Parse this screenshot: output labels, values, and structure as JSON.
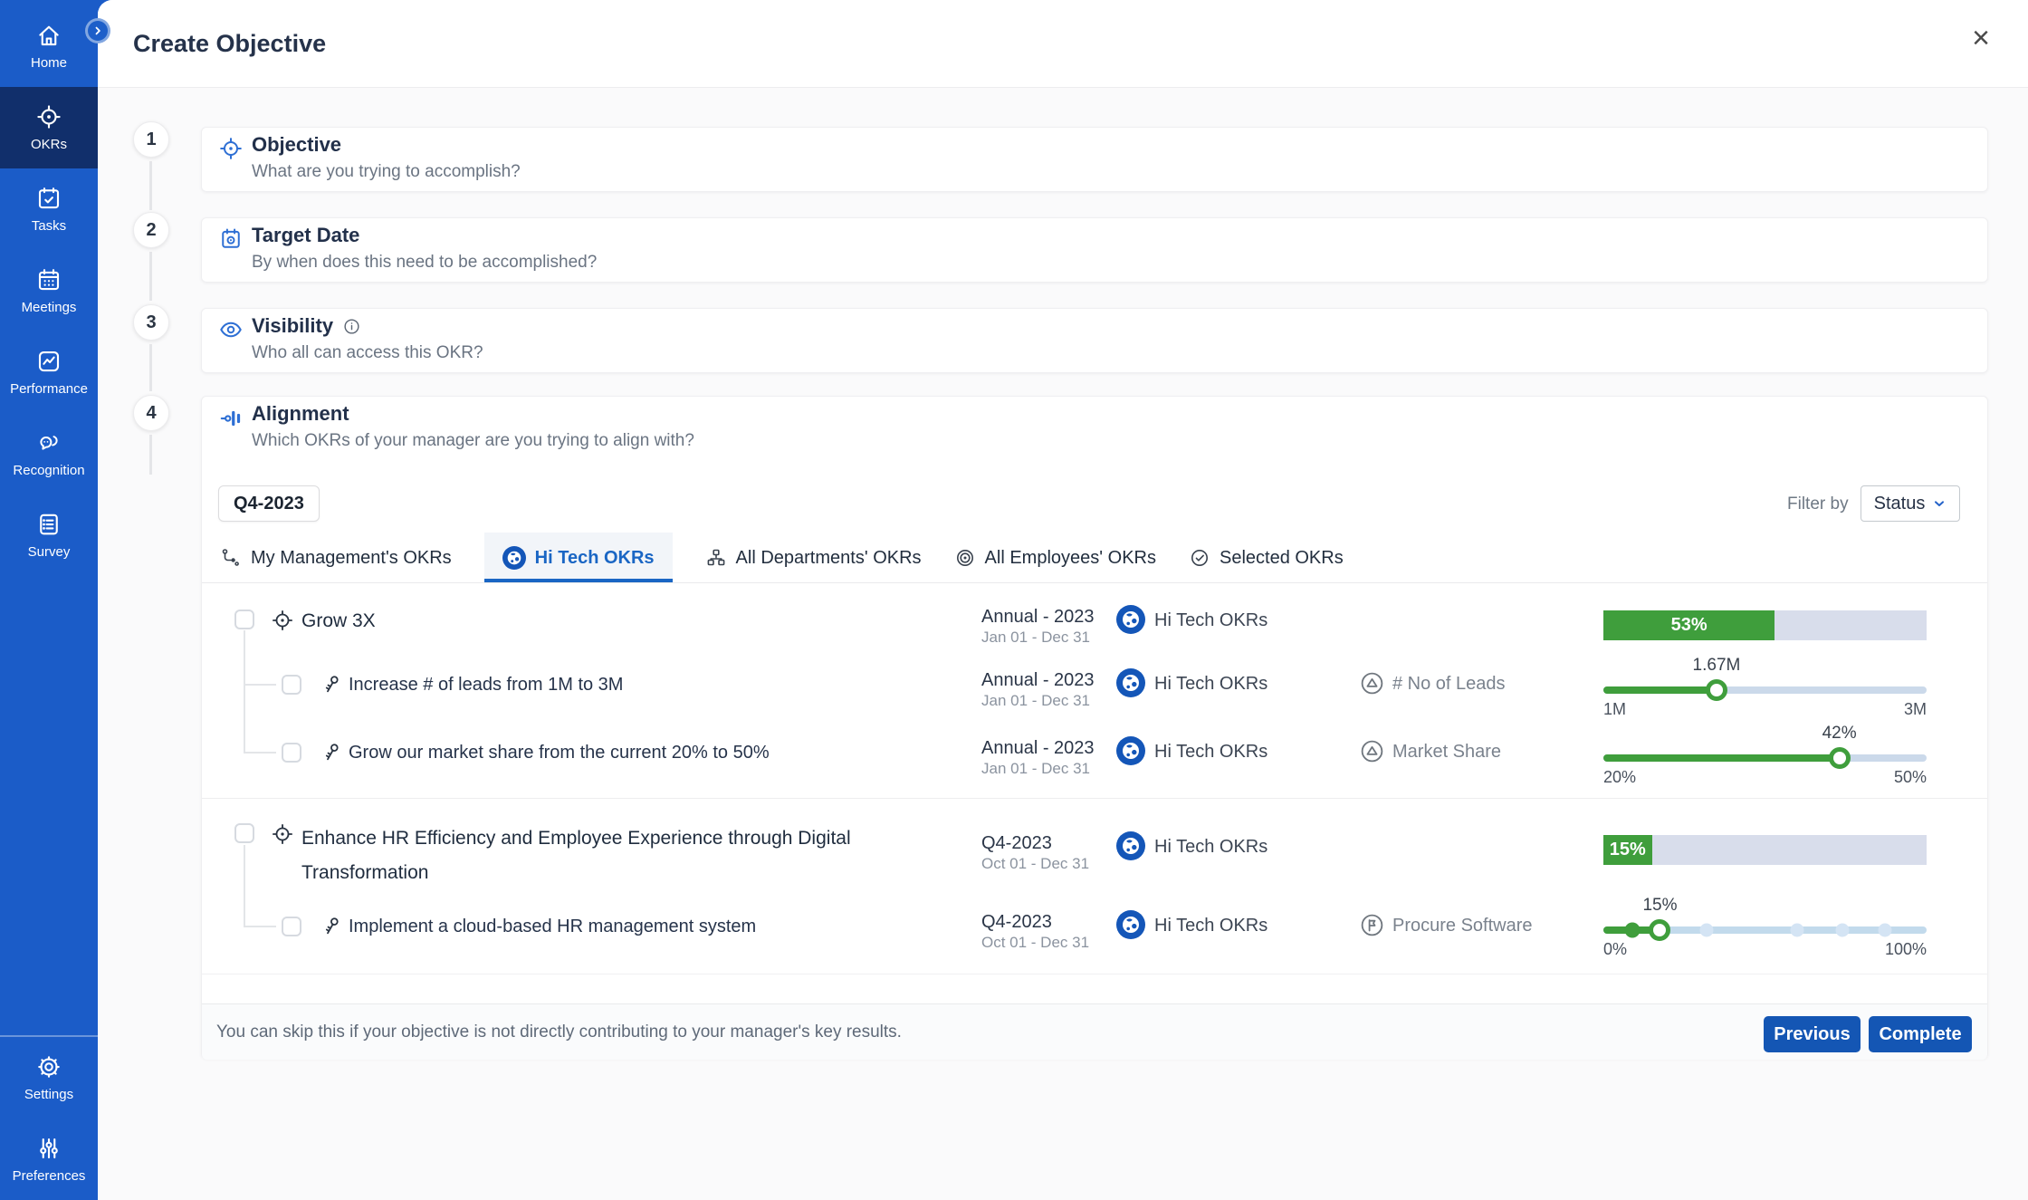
{
  "colors": {
    "sidebar_blue": "#1B5CC8",
    "sidebar_active": "#112F6B",
    "accent_blue": "#1A66C4",
    "step_icon_blue": "#2E6FD4",
    "progress_green": "#3F9E3C",
    "bar_track": "#D8DDEB",
    "slider_track": "#CBD9EA",
    "button_blue": "#1456B4"
  },
  "sidebar": {
    "items": [
      {
        "label": "Home"
      },
      {
        "label": "OKRs"
      },
      {
        "label": "Tasks"
      },
      {
        "label": "Meetings"
      },
      {
        "label": "Performance"
      },
      {
        "label": "Recognition"
      },
      {
        "label": "Survey"
      }
    ],
    "bottom_items": [
      {
        "label": "Settings"
      },
      {
        "label": "Preferences"
      }
    ]
  },
  "header": {
    "title": "Create Objective",
    "close": "×"
  },
  "steps": [
    {
      "number": "1",
      "title": "Objective",
      "subtitle": "What are you trying to accomplish?"
    },
    {
      "number": "2",
      "title": "Target Date",
      "subtitle": "By when does this need to be accomplished?"
    },
    {
      "number": "3",
      "title": "Visibility",
      "subtitle": "Who all can access this OKR?"
    },
    {
      "number": "4",
      "title": "Alignment",
      "subtitle": "Which OKRs of your manager are you trying to align with?"
    }
  ],
  "alignment": {
    "period_chip": "Q4-2023",
    "filter_label": "Filter by",
    "filter_value": "Status",
    "tabs": [
      {
        "label": "My Management's OKRs"
      },
      {
        "label": "Hi Tech OKRs"
      },
      {
        "label": "All Departments' OKRs"
      },
      {
        "label": "All Employees' OKRs"
      },
      {
        "label": "Selected OKRs"
      }
    ],
    "rows": [
      {
        "type": "objective",
        "title": "Grow 3X",
        "period": "Annual - 2023",
        "dates": "Jan 01 - Dec 31",
        "team": "Hi Tech OKRs",
        "progress": {
          "kind": "bar",
          "percent": 53,
          "label": "53%"
        }
      },
      {
        "type": "key_result",
        "title": "Increase # of leads from 1M to 3M",
        "period": "Annual - 2023",
        "dates": "Jan 01 - Dec 31",
        "team": "Hi Tech OKRs",
        "kpi": "# No of Leads",
        "progress": {
          "kind": "slider",
          "percent": 35,
          "label": "1.67M",
          "min": "1M",
          "max": "3M"
        }
      },
      {
        "type": "key_result",
        "title": "Grow our market share from the current 20% to 50%",
        "period": "Annual - 2023",
        "dates": "Jan 01 - Dec 31",
        "team": "Hi Tech OKRs",
        "kpi": "Market Share",
        "progress": {
          "kind": "slider",
          "percent": 73,
          "label": "42%",
          "min": "20%",
          "max": "50%"
        }
      },
      {
        "type": "objective",
        "title": "Enhance HR Efficiency and Employee Experience through Digital Transformation",
        "period": "Q4-2023",
        "dates": "Oct 01 - Dec 31",
        "team": "Hi Tech OKRs",
        "progress": {
          "kind": "bar",
          "percent": 15,
          "label": "15%"
        }
      },
      {
        "type": "key_result",
        "title": "Implement a cloud-based HR management system",
        "period": "Q4-2023",
        "dates": "Oct 01 - Dec 31",
        "team": "Hi Tech OKRs",
        "kpi": "Procure Software",
        "progress": {
          "kind": "milestone",
          "percent": 17.5,
          "label": "15%",
          "min": "0%",
          "max": "100%",
          "done_dot": 9,
          "dots": [
            32,
            60,
            74,
            87
          ]
        }
      }
    ],
    "footer": {
      "note": "You can skip this if your objective is not directly contributing to your manager's key results.",
      "previous_label": "Previous",
      "complete_label": "Complete"
    }
  }
}
